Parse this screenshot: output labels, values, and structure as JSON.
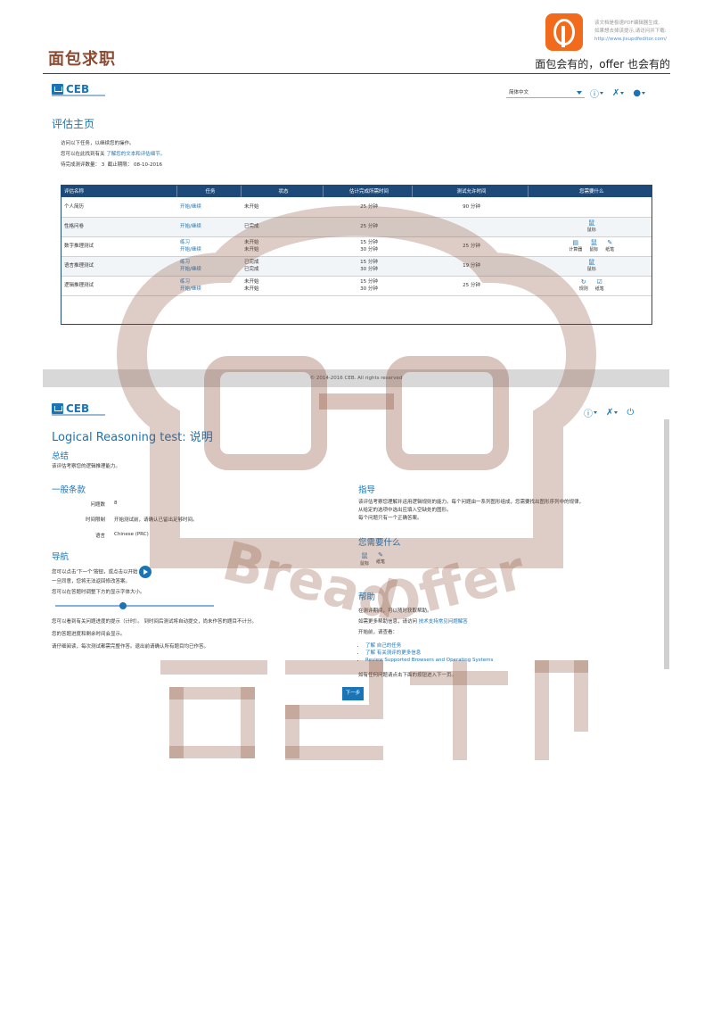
{
  "header": {
    "brand": "面包求职",
    "slogan": "面包会有的，offer 也会有的",
    "pdf_note": [
      "该文档是极速PDF编辑器生成,",
      "如果想去掉该提示,请访问并下载:"
    ],
    "pdf_link": "http://www.jisupdfeditor.com/"
  },
  "top_panel": {
    "logo": "CEB",
    "language": "简体中文",
    "title": "评估主页",
    "info_lines": [
      "访问以下任务，以继续您的操作。",
      "您可以在此找到有关"
    ],
    "info_link": "了解您的文本和评估细节。",
    "pending_label": "待完成测评数量：",
    "pending_count": "3",
    "deadline_label": "截止期限：",
    "deadline": "08-10-2016",
    "columns": [
      "评估名称",
      "任务",
      "状态",
      "估计完成所需时间",
      "测试允许时间",
      "您需要什么"
    ],
    "rows": [
      {
        "name": "个人简历",
        "task": [
          "开始/继续"
        ],
        "status": [
          "未开始"
        ],
        "est": [
          "25 分钟"
        ],
        "allowed": "90 分钟",
        "needs": []
      },
      {
        "name": "性格问卷",
        "task": [
          "开始/继续"
        ],
        "status": [
          "已完成"
        ],
        "est": [
          "25 分钟"
        ],
        "allowed": "",
        "needs": [
          {
            "icon": "鼠",
            "label": "鼠标"
          }
        ]
      },
      {
        "name": "数字推理测试",
        "task": [
          "练习",
          "开始/继续"
        ],
        "status": [
          "未开始",
          "未开始"
        ],
        "est": [
          "15 分钟",
          "30 分钟"
        ],
        "allowed": "25 分钟",
        "needs": [
          {
            "icon": "▤",
            "label": "计算器"
          },
          {
            "icon": "鼠",
            "label": "鼠标"
          },
          {
            "icon": "✎",
            "label": "纸笔"
          }
        ]
      },
      {
        "name": "语言推理测试",
        "task": [
          "练习",
          "开始/继续"
        ],
        "status": [
          "已完成",
          "已完成"
        ],
        "est": [
          "15 分钟",
          "30 分钟"
        ],
        "allowed": "19 分钟",
        "needs": [
          {
            "icon": "鼠",
            "label": "鼠标"
          }
        ]
      },
      {
        "name": "逻辑推理测试",
        "task": [
          "练习",
          "开始/继续"
        ],
        "status": [
          "未开始",
          "未开始"
        ],
        "est": [
          "15 分钟",
          "30 分钟"
        ],
        "allowed": "25 分钟",
        "needs": [
          {
            "icon": "↻",
            "label": "规则"
          },
          {
            "icon": "☑",
            "label": "纸笔"
          }
        ]
      }
    ],
    "copyright": "© 2014-2016 CEB. All rights reserved"
  },
  "bottom_panel": {
    "logo": "CEB",
    "title": "Logical Reasoning test: 说明",
    "summary_title": "总结",
    "summary_text": "该评估考察您的逻辑推理能力。",
    "general_title": "一般条款",
    "general": [
      {
        "k": "问题数",
        "v": "8"
      },
      {
        "k": "时间限制",
        "v": "开始测试前，请确认已留出足够时间。"
      },
      {
        "k": "语言",
        "v": "Chinese (PRC)"
      }
    ],
    "nav_title": "导航",
    "nav_lines": [
      "您可以点击'下一个'按钮，或点击以开始",
      "一旦同意，您将无法返回修改答案。",
      "您可以在答题时调整下方的显示字体大小。"
    ],
    "nav_lines2": [
      "您可以看到有关问题进度的提示（计时）。 到时间后测试将自动提交，尚未作答的题目不计分。",
      "您的答题进度和剩余时间会显示。",
      "请仔细阅读，每次测试都需完整作答。退出前请确认所有题目均已作答。"
    ],
    "guide_title": "指导",
    "guide_text": [
      "该评估考察您理解并运用逻辑规则的能力。每个问题由一系列图形组成，您需要找出图形序列中的规律，",
      "从给定的选项中选出应填入空缺处的图形。",
      "每个问题只有一个正确答案。"
    ],
    "needs_title": "您需要什么",
    "needs": [
      {
        "icon": "鼠",
        "label": "鼠标"
      },
      {
        "icon": "✎",
        "label": "纸笔"
      }
    ],
    "help_title": "帮助",
    "help_text": [
      "在测评期间，可以随时获取帮助。",
      "如需更多帮助信息，请访问",
      "开始前，请查看："
    ],
    "help_link": "技术支持常见问题解答",
    "bullets": [
      "了解 自己的任务",
      "了解 有关测评的更多信息",
      "Review Supported Browsers and Operating Systems"
    ],
    "final_text": "如有任何问题请点击下面的按钮进入下一页。",
    "next_label": "下一步"
  }
}
